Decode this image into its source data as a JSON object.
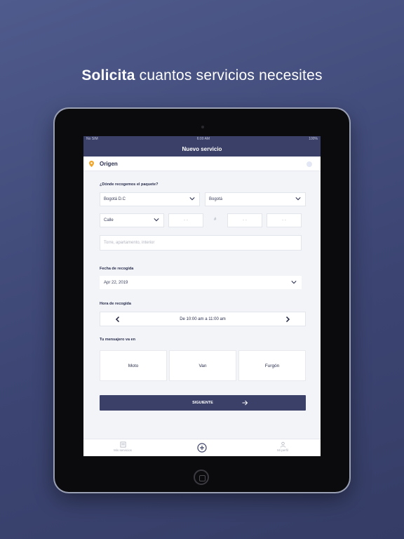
{
  "headline": {
    "bold": "Solicita",
    "rest": " cuantos servicios necesites"
  },
  "status": {
    "carrier": "No SIM",
    "time": "6:00 AM",
    "battery": "100%"
  },
  "nav": {
    "title": "Nuevo servicio"
  },
  "origin": {
    "title": "Origen",
    "pin_color": "#f0a52a"
  },
  "pickup": {
    "question": "¿Dónde recogemos el paquete?",
    "department": "Bogotá D.C",
    "city": "Bogotá",
    "street_type": "Calle",
    "num1_placeholder": "- -",
    "hash": "#",
    "num2_placeholder": "- -",
    "num3_placeholder": "- -",
    "extra_placeholder": "Torre, apartamento, interior"
  },
  "date": {
    "label": "Fecha de recogida",
    "value": "Apr 22, 2019"
  },
  "time": {
    "label": "Hora de recogida",
    "value": "De 10:00 am a 11:00 am"
  },
  "vehicle": {
    "label": "Tu mensajero va en",
    "options": [
      "Moto",
      "Van",
      "Furgón"
    ]
  },
  "next_button": {
    "label": "SIGUIENTE"
  },
  "tabbar": {
    "services": "Mis servicios",
    "profile": "Mi perfil"
  },
  "colors": {
    "primary": "#3b4068",
    "background": "#465080",
    "accent": "#f0a52a"
  }
}
